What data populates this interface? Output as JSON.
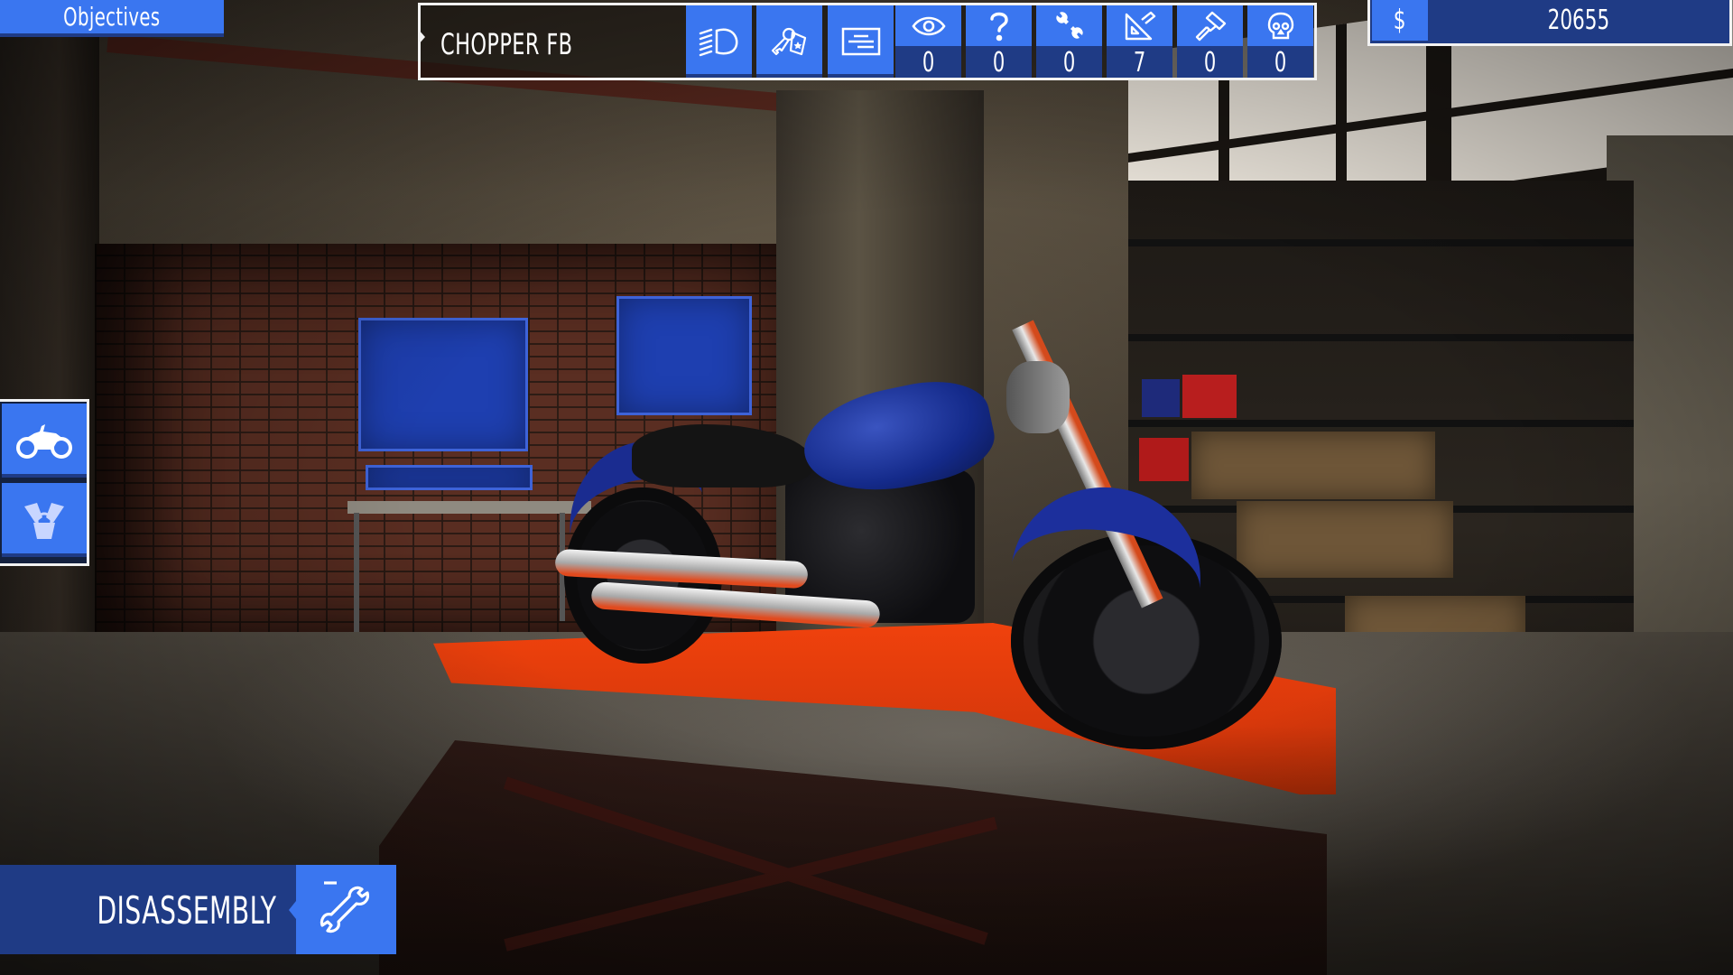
{
  "objectives": {
    "label": "Objectives"
  },
  "top_bar": {
    "vehicle_name": "CHOPPER FB",
    "tool_buttons": [
      {
        "icon": "headlight-icon",
        "label": "Lights"
      },
      {
        "icon": "keys-icon",
        "label": "Keys"
      },
      {
        "icon": "document-icon",
        "label": "Info"
      }
    ],
    "stats": [
      {
        "icon": "eye-icon",
        "value": "0"
      },
      {
        "icon": "question-icon",
        "value": "0"
      },
      {
        "icon": "wrench-icon",
        "value": "0"
      },
      {
        "icon": "ruler-triangle-icon",
        "value": "7"
      },
      {
        "icon": "paint-roller-icon",
        "value": "0"
      },
      {
        "icon": "skull-icon",
        "value": "0"
      }
    ]
  },
  "money": {
    "symbol": "$",
    "amount": "20655"
  },
  "side_panel": {
    "items": [
      {
        "icon": "motorcycle-icon",
        "active": true
      },
      {
        "icon": "engine-icon",
        "active": false
      }
    ]
  },
  "mode_button": {
    "label": "DISASSEMBLY",
    "icon": "wrench-icon"
  },
  "colors": {
    "accent": "#3a76f0",
    "accent_dark": "#1f3b85",
    "frame": "#f2f2f2",
    "text": "#ffffff"
  }
}
